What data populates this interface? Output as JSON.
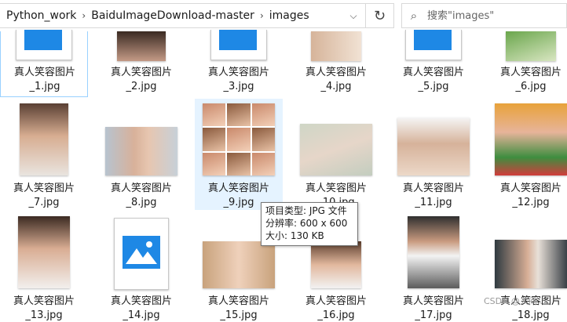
{
  "breadcrumbs": [
    "Python_work",
    "BaiduImageDownload-master",
    "images"
  ],
  "search": {
    "placeholder": "搜索\"images\""
  },
  "files": [
    {
      "line1": "真人笑容图片",
      "line2": "_1.jpg"
    },
    {
      "line1": "真人笑容图片",
      "line2": "_2.jpg"
    },
    {
      "line1": "真人笑容图片",
      "line2": "_3.jpg"
    },
    {
      "line1": "真人笑容图片",
      "line2": "_4.jpg"
    },
    {
      "line1": "真人笑容图片",
      "line2": "_5.jpg"
    },
    {
      "line1": "真人笑容图片",
      "line2": "_6.jpg"
    },
    {
      "line1": "真人笑容图片",
      "line2": "_7.jpg"
    },
    {
      "line1": "真人笑容图片",
      "line2": "_8.jpg"
    },
    {
      "line1": "真人笑容图片",
      "line2": "_9.jpg"
    },
    {
      "line1": "真人笑容图片",
      "line2": "_10.jpg"
    },
    {
      "line1": "真人笑容图片",
      "line2": "_11.jpg"
    },
    {
      "line1": "真人笑容图片",
      "line2": "_12.jpg"
    },
    {
      "line1": "真人笑容图片",
      "line2": "_13.jpg"
    },
    {
      "line1": "真人笑容图片",
      "line2": "_14.jpg"
    },
    {
      "line1": "真人笑容图片",
      "line2": "_15.jpg"
    },
    {
      "line1": "真人笑容图片",
      "line2": "_16.jpg"
    },
    {
      "line1": "真人笑容图片",
      "line2": "_17.jpg"
    },
    {
      "line1": "真人笑容图片",
      "line2": "_18.jpg"
    }
  ],
  "tooltip": {
    "type": "项目类型: JPG 文件",
    "resolution": "分辨率: 600 x 600",
    "size": "大小: 130 KB"
  },
  "watermark": "CSDN @人间..."
}
